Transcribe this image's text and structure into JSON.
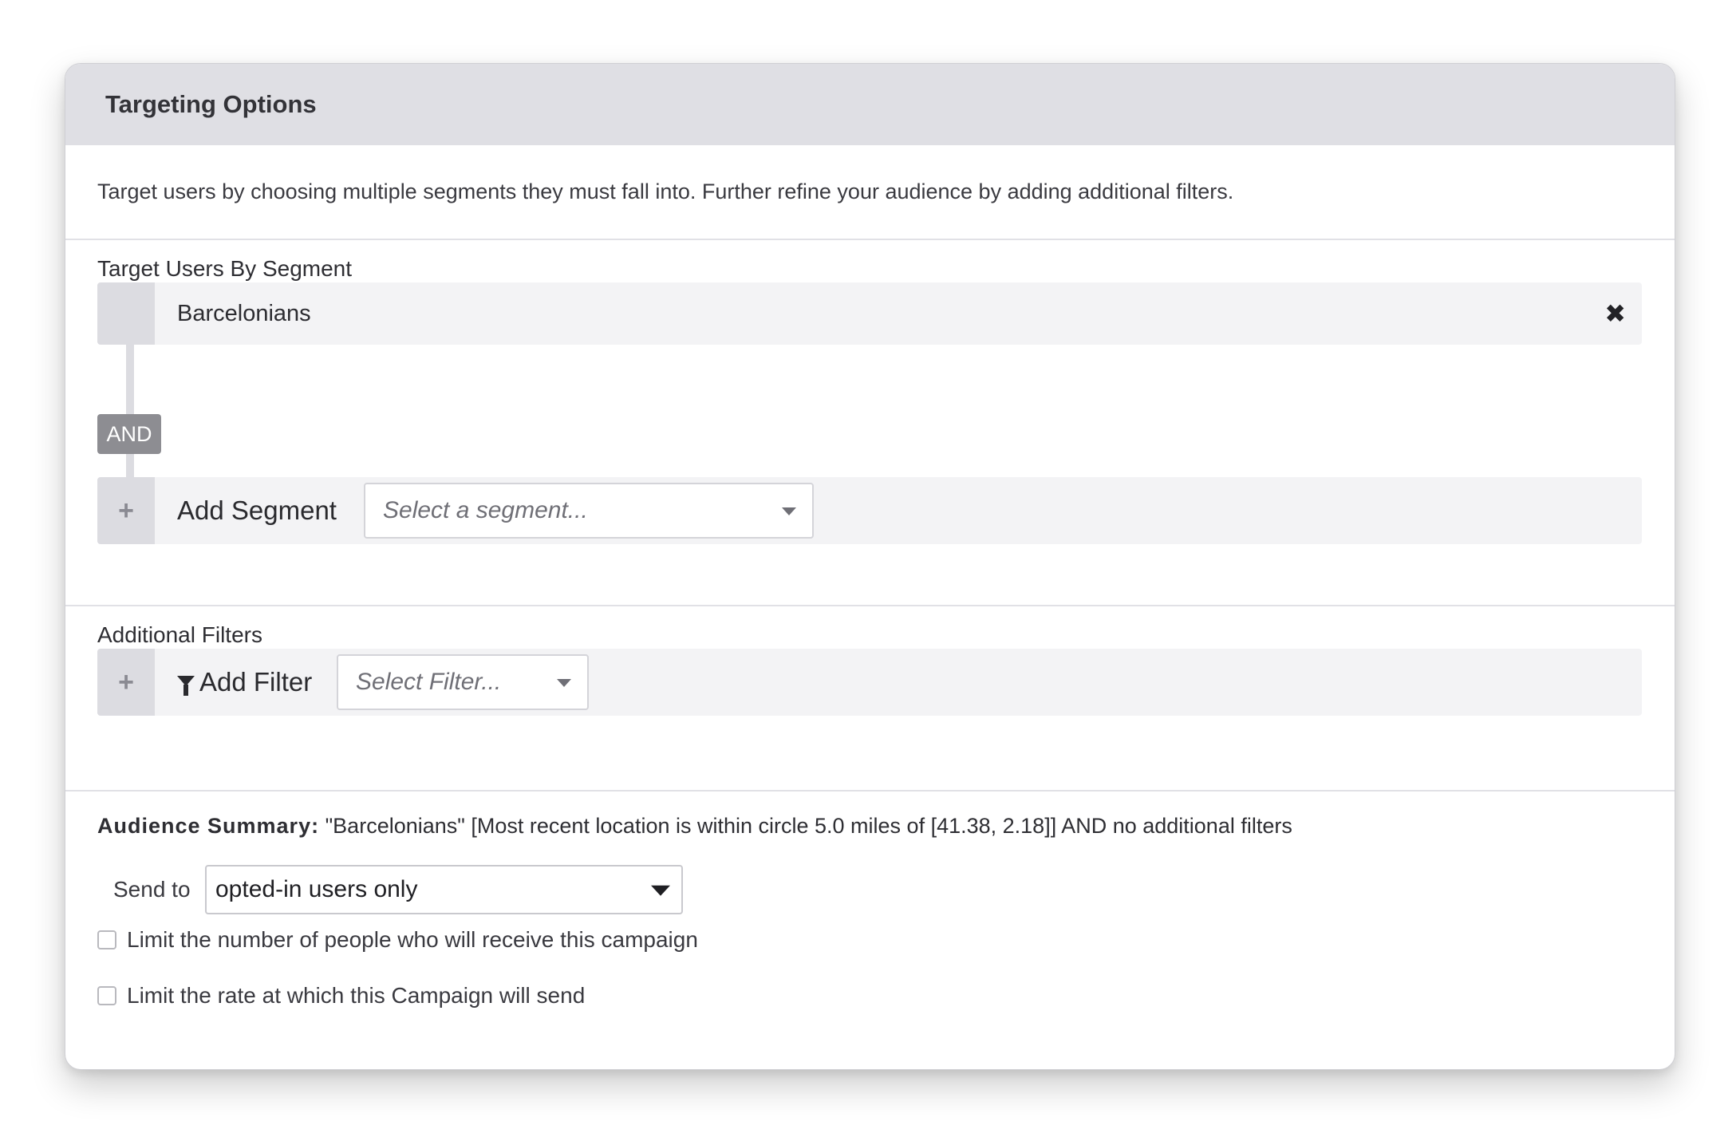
{
  "header": {
    "title": "Targeting Options"
  },
  "intro": {
    "text": "Target users by choosing multiple segments they must fall into. Further refine your audience by adding additional filters."
  },
  "segments": {
    "title": "Target Users By Segment",
    "selected": [
      {
        "name": "Barcelonians"
      }
    ],
    "remove_icon": "close-x-icon",
    "operator": "AND",
    "add_label": "Add Segment",
    "add_icon": "plus-icon",
    "select_placeholder": "Select a segment..."
  },
  "filters": {
    "title": "Additional Filters",
    "add_label": "Add Filter",
    "add_icon": "plus-icon",
    "filter_icon": "funnel-icon",
    "select_placeholder": "Select Filter..."
  },
  "summary": {
    "label": "Audience Summary:",
    "text": "\"Barcelonians\" [Most recent location is within circle 5.0 miles of [41.38, 2.18]] AND no additional filters",
    "send_to_label": "Send to",
    "send_to_value": "opted-in users only",
    "limit_people_label": "Limit the number of people who will receive this campaign",
    "limit_rate_label": "Limit the rate at which this Campaign will send"
  },
  "colors": {
    "header_bg": "#dfdfe4",
    "row_bg": "#f3f3f5",
    "gutter_bg": "#dcdce1",
    "and_badge_bg": "#8d8d92"
  }
}
